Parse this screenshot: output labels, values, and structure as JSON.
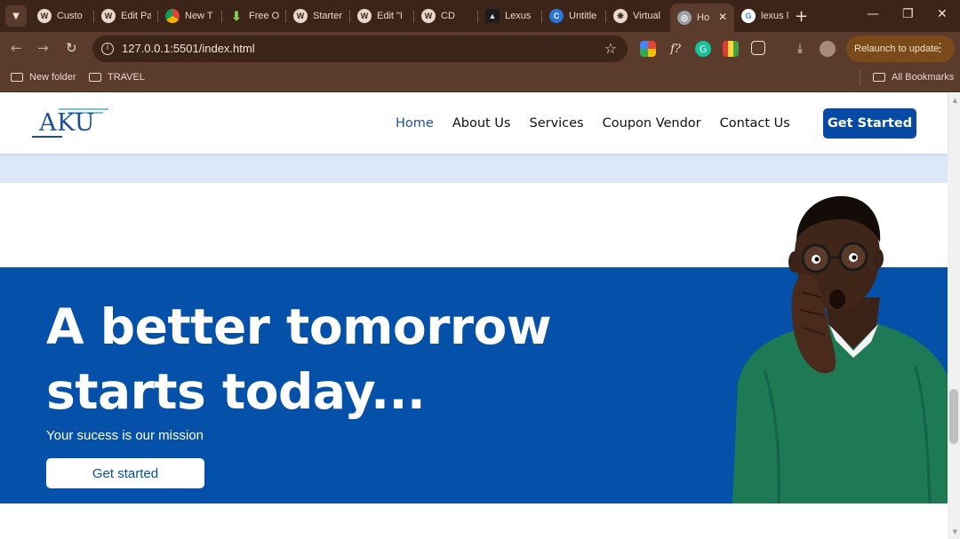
{
  "browser": {
    "tabs": [
      {
        "label": "Custo",
        "icon": "wordpress-icon"
      },
      {
        "label": "Edit Pa",
        "icon": "wordpress-icon"
      },
      {
        "label": "New T",
        "icon": "chrome-icon"
      },
      {
        "label": "Free O",
        "icon": "download-icon"
      },
      {
        "label": "Starter",
        "icon": "wordpress-icon"
      },
      {
        "label": "Edit \"I",
        "icon": "wordpress-icon"
      },
      {
        "label": "CD",
        "icon": "wordpress-icon"
      },
      {
        "label": "Lexus",
        "icon": "lexus-icon"
      },
      {
        "label": "Untitle",
        "icon": "canva-icon"
      },
      {
        "label": "Virtual",
        "icon": "chatgpt-icon"
      },
      {
        "label": "Ho",
        "icon": "globe-icon",
        "active": true
      },
      {
        "label": "lexus l",
        "icon": "google-icon"
      }
    ],
    "url": "127.0.0.1:5501/index.html",
    "relaunch_label": "Relaunch to update",
    "bookmarks": [
      "New folder",
      "TRAVEL"
    ],
    "all_bookmarks_label": "All Bookmarks"
  },
  "site": {
    "logo_text": "AKU",
    "nav": [
      "Home",
      "About Us",
      "Services",
      "Coupon Vendor",
      "Contact Us"
    ],
    "nav_active": "Home",
    "cta_label": "Get Started",
    "hero": {
      "title_line1": "A better tomorrow",
      "title_line2": "starts today...",
      "subtitle": "Your sucess is our mission",
      "button_label": "Get started"
    },
    "colors": {
      "brand_blue": "#0550a9",
      "header_cta": "#064aa6",
      "light_band": "#dbe8f9",
      "browser_frame": "#3c2418"
    }
  }
}
